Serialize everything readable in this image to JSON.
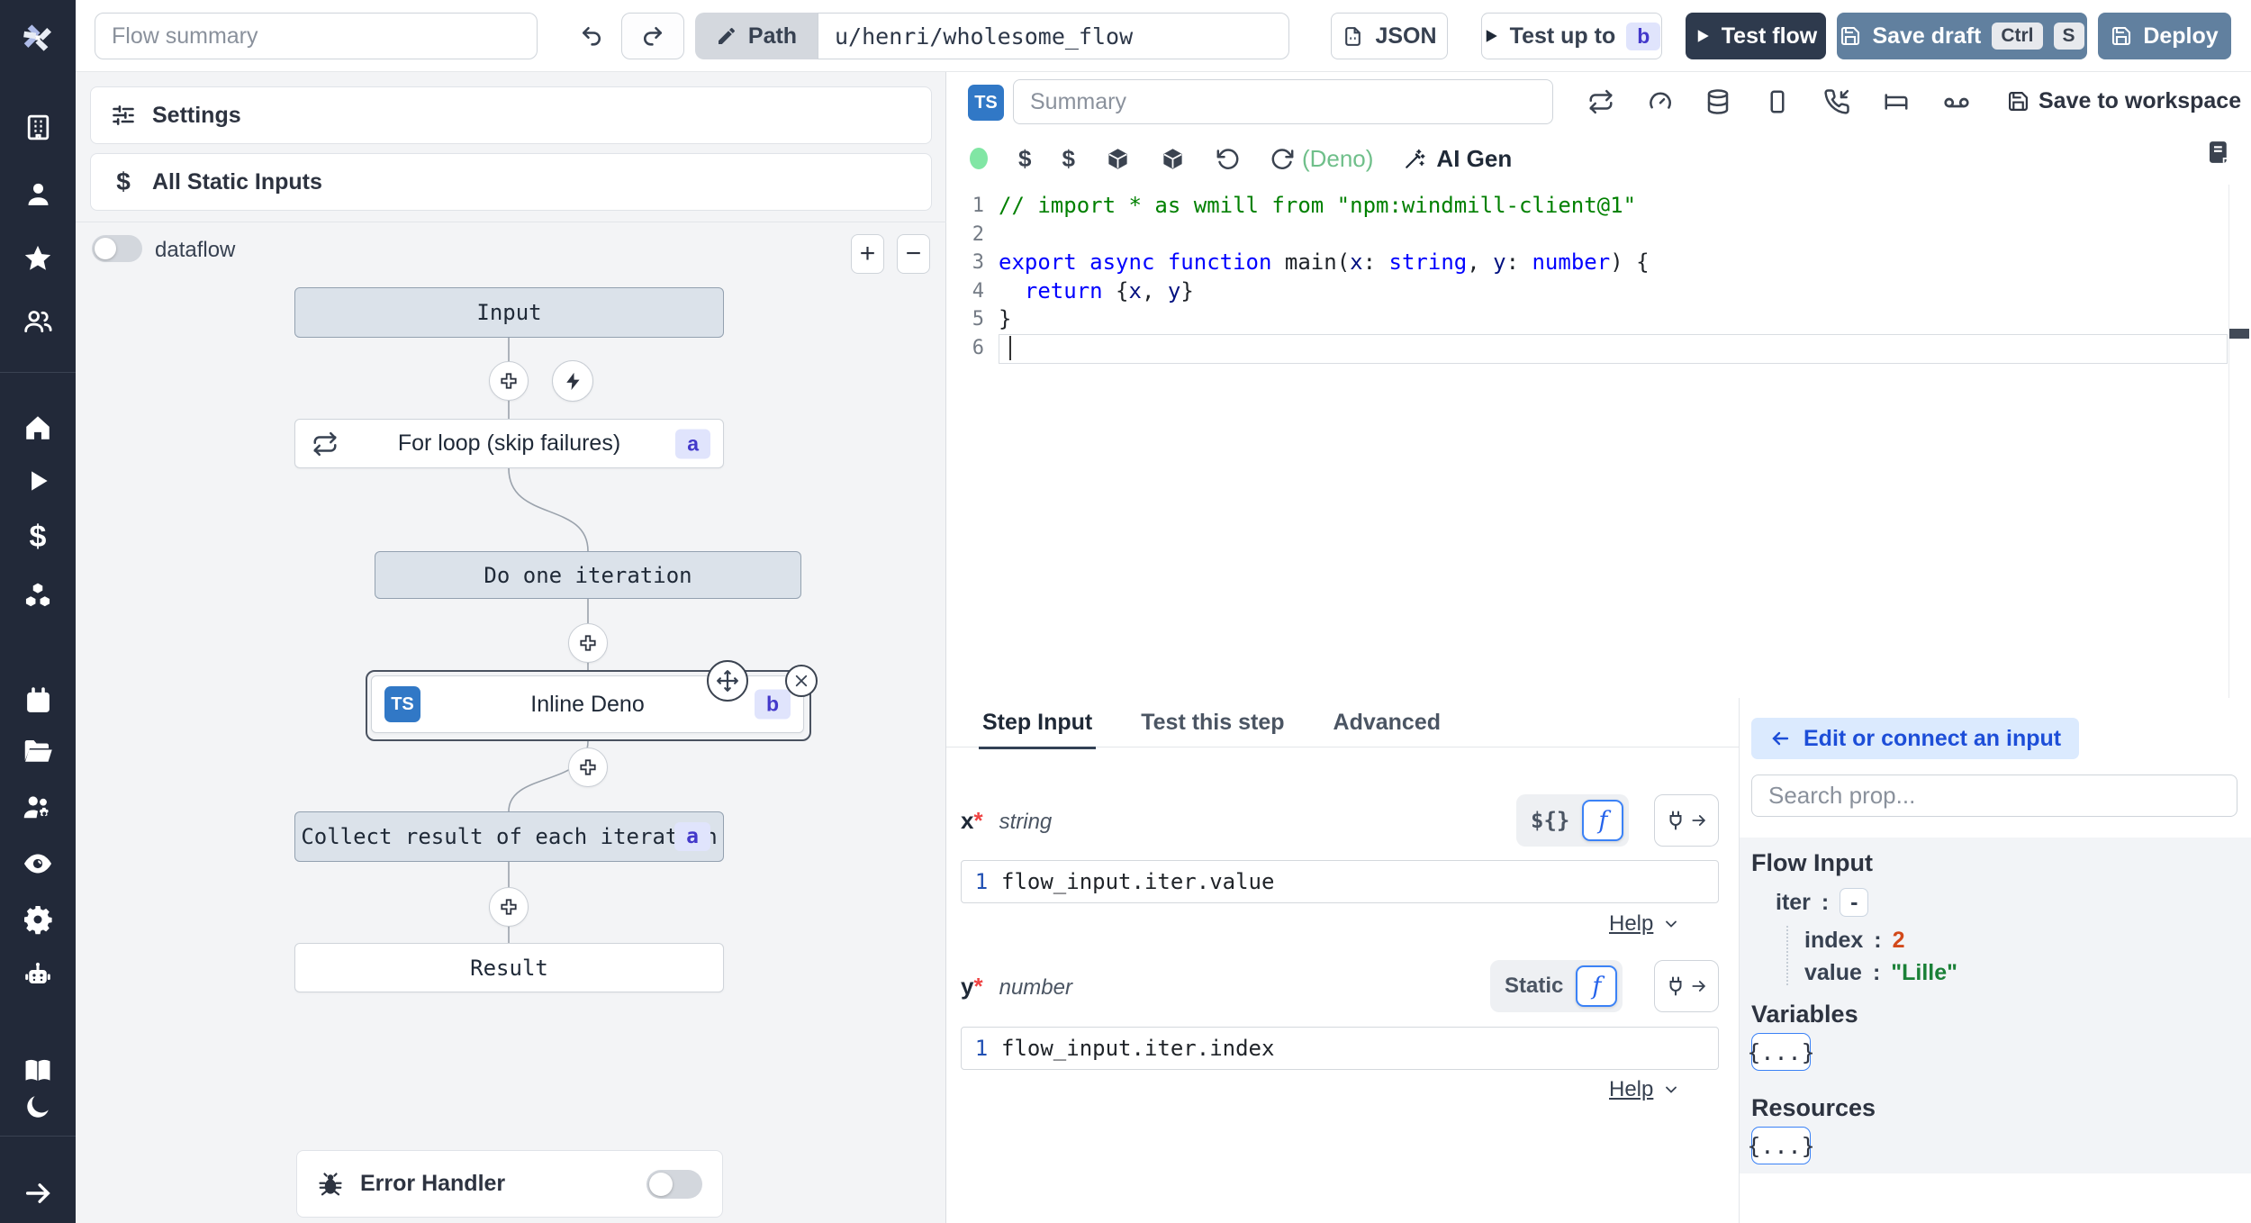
{
  "topbar": {
    "flow_summary_placeholder": "Flow summary",
    "path_label": "Path",
    "path_value": "u/henri/wholesome_flow",
    "json_label": "JSON",
    "test_up_to_label": "Test up to",
    "test_up_to_badge": "b",
    "test_flow_label": "Test flow",
    "save_draft_label": "Save draft",
    "kbd_ctrl": "Ctrl",
    "kbd_s": "S",
    "deploy_label": "Deploy"
  },
  "sidebar": {
    "icons": [
      "windmill-logo",
      "building",
      "user",
      "star",
      "user-group",
      "home",
      "play",
      "dollar",
      "boxes",
      "calendar",
      "folder-open",
      "user-group-gear",
      "eye",
      "settings-gear",
      "robot",
      "book-open",
      "moon",
      "collapse-arrow"
    ]
  },
  "flow_panel": {
    "settings_label": "Settings",
    "static_inputs_label": "All Static Inputs",
    "dataflow_label": "dataflow",
    "zoom_in": "+",
    "zoom_out": "−",
    "nodes": {
      "input": "Input",
      "for_loop": "For loop (skip failures)",
      "for_loop_badge": "a",
      "do_one_iteration": "Do one iteration",
      "inline_deno": "Inline Deno",
      "inline_deno_lang": "TS",
      "inline_deno_badge": "b",
      "collect": "Collect result of each iteration",
      "collect_badge": "a",
      "result": "Result"
    },
    "error_handler_label": "Error Handler"
  },
  "editor": {
    "lang_badge": "TS",
    "summary_placeholder": "Summary",
    "save_to_workspace_label": "Save to workspace",
    "runtime_label": "(Deno)",
    "ai_gen_label": "AI Gen",
    "code": {
      "lines": [
        {
          "n": "1",
          "tokens": [
            {
              "t": "// import * as wmill from \"npm:windmill-client@1\"",
              "c": "com"
            }
          ]
        },
        {
          "n": "2",
          "tokens": []
        },
        {
          "n": "3",
          "tokens": [
            {
              "t": "export",
              "c": "kw"
            },
            {
              "t": " "
            },
            {
              "t": "async",
              "c": "kw"
            },
            {
              "t": " "
            },
            {
              "t": "function",
              "c": "kw"
            },
            {
              "t": " main("
            },
            {
              "t": "x",
              "c": "param"
            },
            {
              "t": ": "
            },
            {
              "t": "string",
              "c": "type"
            },
            {
              "t": ", "
            },
            {
              "t": "y",
              "c": "param"
            },
            {
              "t": ": "
            },
            {
              "t": "number",
              "c": "type"
            },
            {
              "t": ") {"
            }
          ]
        },
        {
          "n": "4",
          "tokens": [
            {
              "t": "  "
            },
            {
              "t": "return",
              "c": "kw"
            },
            {
              "t": " {"
            },
            {
              "t": "x",
              "c": "param"
            },
            {
              "t": ", "
            },
            {
              "t": "y",
              "c": "param"
            },
            {
              "t": "}"
            }
          ]
        },
        {
          "n": "5",
          "tokens": [
            {
              "t": "}"
            }
          ]
        },
        {
          "n": "6",
          "tokens": [],
          "cursor": true
        }
      ]
    }
  },
  "tabs": {
    "step_input": "Step Input",
    "test_this_step": "Test this step",
    "advanced": "Advanced"
  },
  "step_input": {
    "x": {
      "name": "x",
      "required_mark": "*",
      "type": "string",
      "mode_label": "${}",
      "line_no": "1",
      "expr": "flow_input.iter.value",
      "help_label": "Help"
    },
    "y": {
      "name": "y",
      "required_mark": "*",
      "type": "number",
      "mode_label": "Static",
      "line_no": "1",
      "expr": "flow_input.iter.index",
      "help_label": "Help"
    }
  },
  "docs_panel": {
    "edit_connect_label": "Edit or connect an input",
    "search_placeholder": "Search prop...",
    "flow_input_title": "Flow Input",
    "tree": {
      "iter_key": "iter",
      "iter_toggle": "-",
      "index_key": "index",
      "index_value": "2",
      "value_key": "value",
      "value_value": "\"Lille\""
    },
    "variables_title": "Variables",
    "variables_button": "{...}",
    "resources_title": "Resources",
    "resources_button": "{...}"
  },
  "colors": {
    "sidebar_bg": "#222939",
    "steel_blue_button": "#61809f",
    "dark_navy_button": "#2e3a4d",
    "ts_badge_blue": "#3178c6",
    "indigo_badge_bg": "#e0e4fc",
    "indigo_badge_text": "#4338ca",
    "code_keyword": "#0000ff",
    "code_comment": "#008000",
    "value_number_orange": "#d2491a",
    "value_string_green": "#1a8037",
    "runtime_green": "#6fbf8a",
    "status_dot_green": "#81e6a4",
    "edit_button_bg": "#dbeafe",
    "edit_button_text": "#1d4ed8"
  }
}
